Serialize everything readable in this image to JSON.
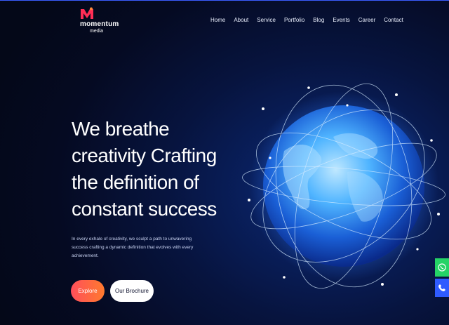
{
  "brand": {
    "name": "momentum",
    "sub": "media",
    "mark_color": "#ff2d55"
  },
  "nav": [
    "Home",
    "About",
    "Service",
    "Portfolio",
    "Blog",
    "Events",
    "Career",
    "Contact"
  ],
  "hero": {
    "line1": "We breathe",
    "line2": "creativity Crafting",
    "line3": "the definition of",
    "line4": "constant success",
    "description": "In every exhale of creativity, we sculpt a path to unwavering success crafting a dynamic definition that evolves with every achievement."
  },
  "buttons": {
    "explore": "Explore",
    "brochure": "Our Brochure"
  },
  "floating": [
    {
      "name": "whatsapp",
      "icon": "whatsapp-icon",
      "color": "#25d366"
    },
    {
      "name": "phone",
      "icon": "phone-icon",
      "color": "#2f5bff"
    }
  ],
  "colors": {
    "accent_start": "#ff4f5b",
    "accent_end": "#ff7a2e",
    "background": "#050a22"
  }
}
